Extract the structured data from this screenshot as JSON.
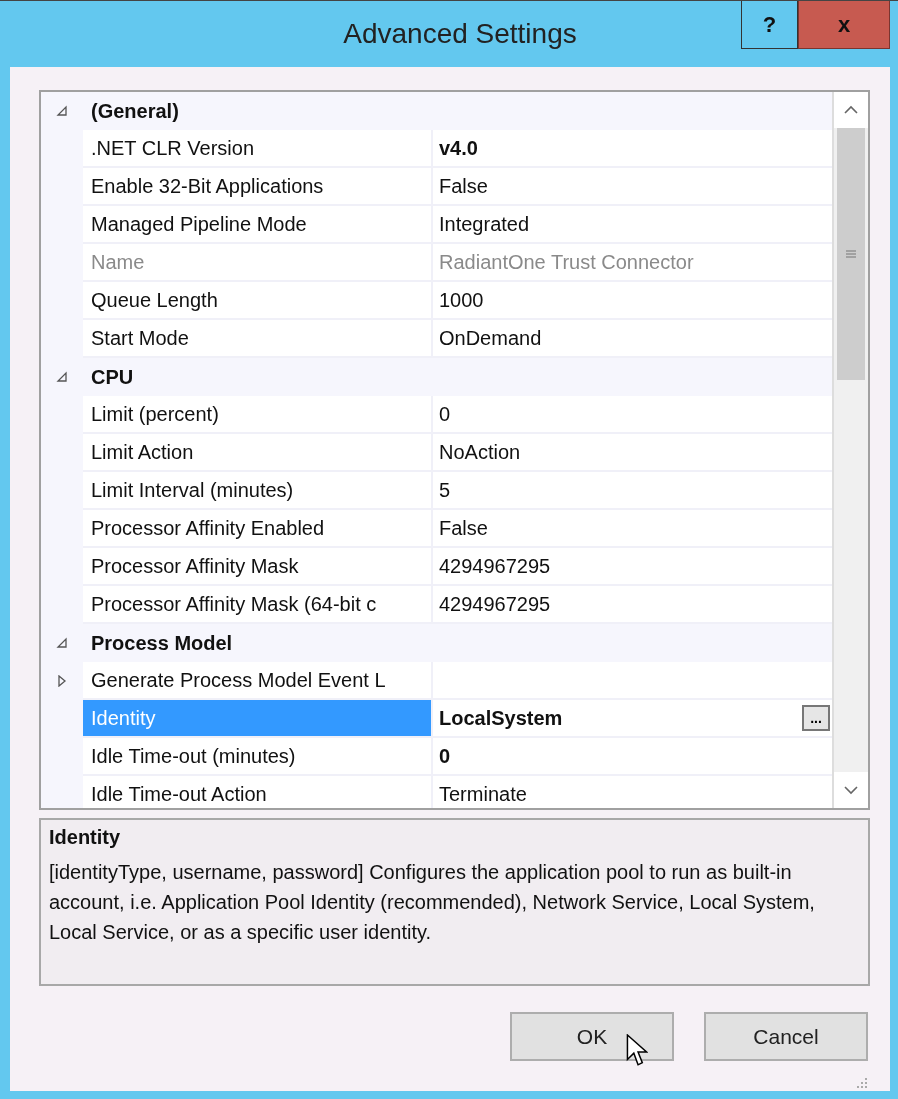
{
  "window": {
    "title": "Advanced Settings",
    "help_button": "?",
    "close_button": "x"
  },
  "grid": {
    "categories": [
      {
        "label": "(General)",
        "expanded": true,
        "properties": [
          {
            "name": ".NET CLR Version",
            "value": "v4.0",
            "modified": true,
            "disabled": false,
            "selected": false
          },
          {
            "name": "Enable 32-Bit Applications",
            "value": "False",
            "modified": false,
            "disabled": false,
            "selected": false
          },
          {
            "name": "Managed Pipeline Mode",
            "value": "Integrated",
            "modified": false,
            "disabled": false,
            "selected": false
          },
          {
            "name": "Name",
            "value": "RadiantOne Trust Connector",
            "modified": false,
            "disabled": true,
            "selected": false
          },
          {
            "name": "Queue Length",
            "value": "1000",
            "modified": false,
            "disabled": false,
            "selected": false
          },
          {
            "name": "Start Mode",
            "value": "OnDemand",
            "modified": false,
            "disabled": false,
            "selected": false
          }
        ]
      },
      {
        "label": "CPU",
        "expanded": true,
        "properties": [
          {
            "name": "Limit (percent)",
            "value": "0",
            "modified": false,
            "disabled": false,
            "selected": false
          },
          {
            "name": "Limit Action",
            "value": "NoAction",
            "modified": false,
            "disabled": false,
            "selected": false
          },
          {
            "name": "Limit Interval (minutes)",
            "value": "5",
            "modified": false,
            "disabled": false,
            "selected": false
          },
          {
            "name": "Processor Affinity Enabled",
            "value": "False",
            "modified": false,
            "disabled": false,
            "selected": false
          },
          {
            "name": "Processor Affinity Mask",
            "value": "4294967295",
            "modified": false,
            "disabled": false,
            "selected": false
          },
          {
            "name": "Processor Affinity Mask (64-bit c",
            "value": "4294967295",
            "modified": false,
            "disabled": false,
            "selected": false
          }
        ]
      },
      {
        "label": "Process Model",
        "expanded": true,
        "properties": [
          {
            "name": "Generate Process Model Event L",
            "expanded": false,
            "disabled": false,
            "selected": false
          },
          {
            "name": "Identity",
            "value": "LocalSystem",
            "button": "...",
            "modified": true,
            "disabled": false,
            "selected": true
          },
          {
            "name": "Idle Time-out (minutes)",
            "value": "0",
            "modified": true,
            "disabled": false,
            "selected": false
          },
          {
            "name": "Idle Time-out Action",
            "value": "Terminate",
            "modified": false,
            "disabled": false,
            "selected": false
          }
        ]
      }
    ]
  },
  "description": {
    "title": "Identity",
    "text": "[identityType, username, password] Configures the application pool to run as built-in account, i.e. Application Pool Identity (recommended), Network Service, Local System, Local Service, or as a specific user identity."
  },
  "buttons": [
    {
      "label": "OK"
    },
    {
      "label": "Cancel"
    }
  ]
}
